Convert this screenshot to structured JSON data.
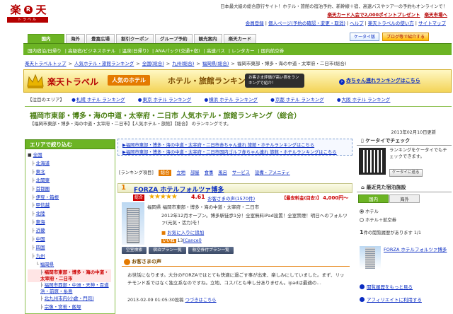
{
  "header": {
    "logo_main": "楽",
    "logo_r": "R",
    "logo_main2": "天",
    "logo_sub": "トラベル",
    "tagline": "日本最大級の総合旅行サイト！ホテル・旅館の宿泊予約、新幹線＋宿、高速バスやツアーの予約もオンラインで！",
    "links1": [
      "楽天カード入会で2,000ポイントプレゼント",
      "楽天市場へ"
    ],
    "links2": [
      "会員登録",
      "個人ページ(予約の確認・変更・取消)",
      "ヘルプ",
      "楽天トラベルの使い方",
      "サイトマップ"
    ]
  },
  "tabs": [
    "国内",
    "海外",
    "豊富広場",
    "割引クーポン",
    "グループ予約",
    "観光案内",
    "楽天カード"
  ],
  "tab_buttons": [
    "ケータイ版",
    "ブログ等で紹介する"
  ],
  "subnav": [
    "国内宿泊/日帰り",
    "高級宿/ビジネスホテル",
    "温泉(日帰り)",
    "ANAパック(交通+宿)",
    "高速バス",
    "レンタカー",
    "国内航空券"
  ],
  "breadcrumb": [
    "楽天トラベルトップ",
    "人気ホテル・旅館ランキング",
    "全国(総合)",
    "九州(総合)",
    "福岡県(総合)",
    "福岡市東部・博多・海の中道・太宰府・二日市(総合)"
  ],
  "banner": {
    "title": "楽天トラベル",
    "pill": "人気のホテル",
    "rank": "ホテル・旅館ランキング",
    "bubble": "お客さま評価が高い宿をランキングで紹介！",
    "right_link": "赤ちゃん連れランキングはこちら"
  },
  "attention": {
    "label": "【注目のエリア】",
    "items": [
      "札幌 ホテル ランキング",
      "東京 ホテル ランキング",
      "横浜 ホテル ランキング",
      "京都 ホテル ランキング",
      "大阪 ホテル ランキング"
    ]
  },
  "page": {
    "title": "福岡市東部・博多・海の中道・太宰府・二日市 人気ホテル・旅館ランキング（総合）",
    "desc": "【福岡市東部・博多・海の中道・太宰府・二日市】【人気ホテル・旅館】【総合】 のランキングです。",
    "date": "2013年02月10日更新"
  },
  "sidebar": {
    "heading": "エリアで絞り込む",
    "items": [
      "全国",
      "北海道",
      "東北",
      "北関東",
      "首都圏",
      "伊豆・箱根",
      "甲信越",
      "北陸",
      "東海",
      "近畿",
      "中国",
      "四国",
      "九州",
      "福岡県",
      "福岡市東部・博多・海の中道・太宰府・二日市",
      "福岡市西部・中洲・天神・百道浜・前原・糸島",
      "北九州市内(小倉・門司)",
      "宗像・宮若・飯塚"
    ]
  },
  "announce": [
    "福岡市東部・博多・海の中道・太宰府・二日市赤ちゃん連れ 旅館・ホテルランキングはこちら",
    "福岡市東部・博多・海の中道・太宰府・二日市国内ゴルフ赤ちゃん連れ 旅館・ホテルランキングはこちら"
  ],
  "filters": {
    "label": "[ランキング項目]",
    "items": [
      "総合",
      "立地",
      "部屋",
      "食事",
      "風呂",
      "サービス",
      "設備・アメニティ"
    ]
  },
  "hotel": {
    "rank": "1",
    "name": "FORZA ホテルフォルツァ博多",
    "badge": "総合",
    "stars": "★★★★★",
    "score": "4.61",
    "voices": "お客さまの声(1570件)",
    "price_label": "【最安料金(目安)】",
    "price": "4,000円〜",
    "area": "福岡県 福岡市東部・博多・海の中道・太宰府・二日市",
    "description": "2012年12月オープン。博多駅徒歩1分！全室無料iPad設置！全室禁煙！明日へのフォルツァ(元気・活力)を！",
    "favorite": "お気に入りに追加",
    "like_label": "いいね",
    "like_count": "13",
    "like_cancel": "(Cancel)",
    "buttons": [
      "空室検索",
      "宿泊プラン一覧",
      "航空券付プラン一覧"
    ],
    "review_heading": "お客さまの声",
    "review": "お世話になります。大分のFORZAではとても快適に過ごす事が出来、楽しみにしていました。まず、リッチモンド系ではなく独立系なのですね。立地、コスパとも申し分ありません。ipadは最適の…",
    "review_date": "2013-02-09 01:05:30投稿",
    "review_more": "つづきはこちら"
  },
  "right": {
    "mobile_heading": "ケータイでチェック",
    "mobile_text": "ランキングをケータイでもチェックできます。",
    "mobile_button": "ケータイに送る",
    "near_heading": "最近見た宿泊施設",
    "near_tabs": [
      "国内",
      "海外"
    ],
    "radio1": "ホテル",
    "radio2": "ホテル",
    "radio2_suffix": "＋航空券",
    "prog_num": "1",
    "prog_text": "件の閲覧履歴があります",
    "prog_page": "1/1",
    "near_name": "FORZA ホテルフォルツァ博多",
    "link1": "閲覧履歴をもっと見る",
    "link2": "アフィリエイトに利用する"
  }
}
